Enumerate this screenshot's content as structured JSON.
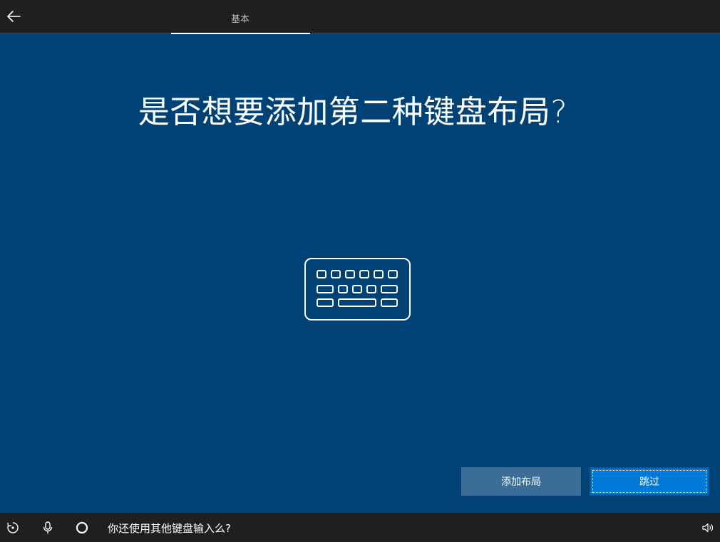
{
  "header": {
    "back_icon": "back-arrow-icon",
    "tabs": [
      {
        "label": "基本",
        "active": true
      }
    ]
  },
  "main": {
    "title": "是否想要添加第二种键盘布局?",
    "illustration_icon": "keyboard-icon",
    "buttons": {
      "add_layout": "添加布局",
      "skip": "跳过"
    }
  },
  "taskbar": {
    "icons": [
      "accessibility-icon",
      "microphone-icon",
      "cortana-circle-icon",
      "volume-icon"
    ],
    "cortana_prompt": "你还使用其他键盘输入么?"
  },
  "colors": {
    "background": "#004275",
    "topbar": "#1f1f1f",
    "secondary_button": "#3c6d96",
    "primary_button": "#0078d7"
  }
}
